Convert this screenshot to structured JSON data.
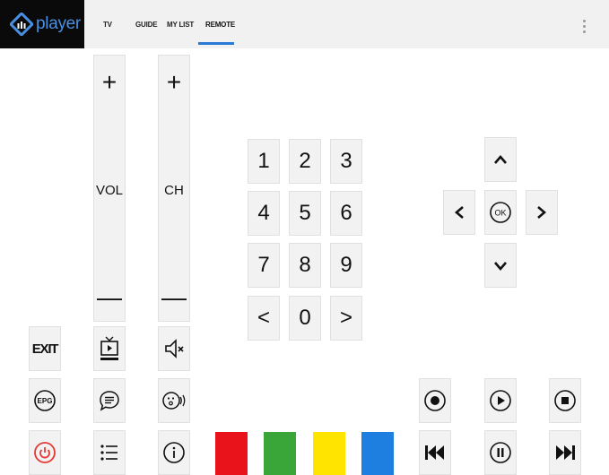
{
  "app": {
    "brand": "player"
  },
  "nav": {
    "tabs": [
      {
        "label": "TV"
      },
      {
        "label": "GUIDE"
      },
      {
        "label": "MY LIST"
      },
      {
        "label": "REMOTE"
      }
    ],
    "active_tab": "REMOTE"
  },
  "remote": {
    "volume": {
      "label": "VOL",
      "up": "+",
      "down": "—"
    },
    "channel": {
      "label": "CH",
      "up": "+",
      "down": "—"
    },
    "keypad": [
      "1",
      "2",
      "3",
      "4",
      "5",
      "6",
      "7",
      "8",
      "9",
      "<",
      "0",
      ">"
    ],
    "dpad": {
      "ok": "OK"
    },
    "exit_label": "EXIT",
    "epg_label": "EPG",
    "color_buttons": [
      "#e8131b",
      "#3aa63a",
      "#ffe400",
      "#1e7fe0"
    ]
  },
  "colors": {
    "accent": "#2979d6",
    "power_red": "#e53935",
    "logo_blue": "#4a90e2"
  },
  "icons": [
    "menu-dots-icon",
    "tv-input-icon",
    "mute-icon",
    "epg-icon",
    "subtitles-icon",
    "audio-description-icon",
    "power-icon",
    "list-icon",
    "info-icon",
    "record-icon",
    "play-icon",
    "stop-icon",
    "skip-back-icon",
    "pause-icon",
    "skip-forward-icon"
  ]
}
